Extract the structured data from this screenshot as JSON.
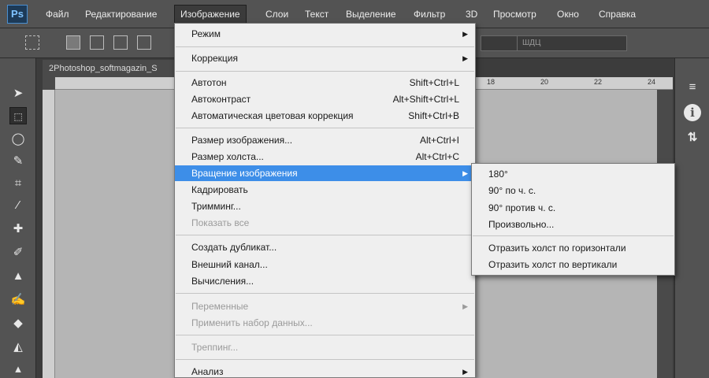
{
  "app": {
    "logo": "Ps"
  },
  "menubar": {
    "items": [
      "Файл",
      "Редактирование",
      "Изображение",
      "Слои",
      "Текст",
      "Выделение",
      "Фильтр",
      "3D",
      "Просмотр",
      "Окно",
      "Справка"
    ],
    "active": "Изображение"
  },
  "options": {
    "field_label": "ШДЦ"
  },
  "document": {
    "tab_title": "2Photoshop_softmagazin_S",
    "ruler_marks": [
      "18",
      "20",
      "22",
      "24"
    ]
  },
  "image_menu": {
    "items": [
      {
        "label": "Режим",
        "submenu": true
      },
      {
        "label": "Коррекция",
        "submenu": true
      },
      {
        "label": "Автотон",
        "shortcut": "Shift+Ctrl+L"
      },
      {
        "label": "Автоконтраст",
        "shortcut": "Alt+Shift+Ctrl+L"
      },
      {
        "label": "Автоматическая цветовая коррекция",
        "shortcut": "Shift+Ctrl+B"
      },
      {
        "label": "Размер изображения...",
        "shortcut": "Alt+Ctrl+I"
      },
      {
        "label": "Размер холста...",
        "shortcut": "Alt+Ctrl+C"
      },
      {
        "label": "Вращение изображения",
        "submenu": true,
        "highlighted": true
      },
      {
        "label": "Кадрировать"
      },
      {
        "label": "Тримминг..."
      },
      {
        "label": "Показать все",
        "disabled": true
      },
      {
        "label": "Создать дубликат..."
      },
      {
        "label": "Внешний канал..."
      },
      {
        "label": "Вычисления..."
      },
      {
        "label": "Переменные",
        "submenu": true,
        "disabled": true
      },
      {
        "label": "Применить набор данных...",
        "disabled": true
      },
      {
        "label": "Треппинг...",
        "disabled": true
      },
      {
        "label": "Анализ",
        "submenu": true
      }
    ]
  },
  "rotate_submenu": {
    "items": [
      "180°",
      "90° по ч. с.",
      "90° против ч. с.",
      "Произвольно...",
      "Отразить холст по горизонтали",
      "Отразить холст по вертикали"
    ]
  },
  "colors": {
    "highlight": "#3d8ee8",
    "menu_bg": "#efefef",
    "chrome": "#535353",
    "canvas": "#b5b5b5"
  }
}
